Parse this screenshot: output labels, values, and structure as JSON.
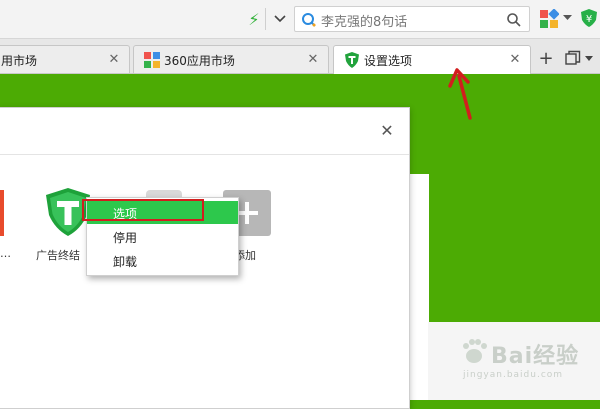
{
  "addressbar": {
    "search_placeholder": "李克强的8句话"
  },
  "tabs": [
    {
      "title": "用市场",
      "active": false
    },
    {
      "title": "360应用市场",
      "active": false
    },
    {
      "title": "设置选项",
      "active": true
    }
  ],
  "dialog": {
    "title_fragment": "‌",
    "extensions": [
      {
        "label": "…",
        "icon": "red-extension-icon"
      },
      {
        "label": "广告终结",
        "icon": "adblock-shield-icon"
      },
      {
        "label": "添加",
        "icon": "add-plus-icon"
      }
    ]
  },
  "context_menu": {
    "items": [
      {
        "label": "选项",
        "active": true
      },
      {
        "label": "停用",
        "active": false
      },
      {
        "label": "卸载",
        "active": false
      }
    ]
  },
  "watermark": {
    "text": "Bai经验",
    "sub": "jingyan.baidu.com"
  },
  "colors": {
    "page_background": "#4cab04",
    "menu_highlight": "#2dc84c",
    "annotation_red": "#d21e1e"
  }
}
